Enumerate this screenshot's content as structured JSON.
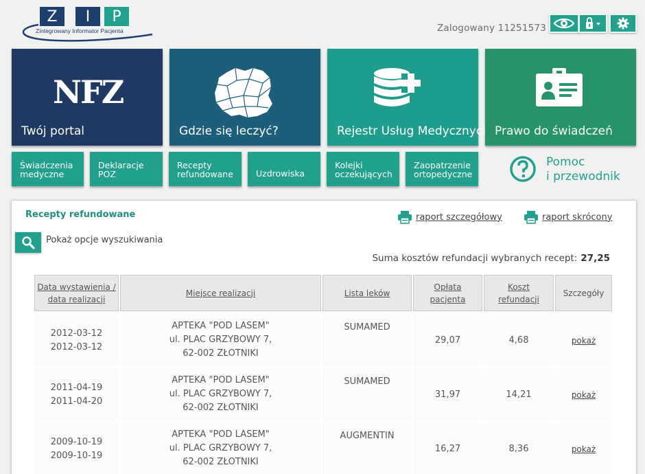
{
  "header": {
    "logo": {
      "letters": [
        "Z",
        "I",
        "P"
      ],
      "subtitle": "Zintegrowany Informator Pacjenta"
    },
    "logged_in": "Zalogowany 11251573",
    "buttons": [
      {
        "icon": "eye-icon"
      },
      {
        "icon": "lock-icon"
      },
      {
        "icon": "gear-icon"
      }
    ]
  },
  "tiles": [
    {
      "label": "Twój portal",
      "logo_text": "NFZ",
      "icon": "nfz-logo"
    },
    {
      "label": "Gdzie się leczyć?",
      "icon": "poland-map-icon"
    },
    {
      "label": "Rejestr Usług Medycznych",
      "icon": "database-plus-icon"
    },
    {
      "label": "Prawo do świadczeń",
      "icon": "id-card-icon"
    }
  ],
  "small_tiles": [
    {
      "line1": "Świadczenia",
      "line2": "medyczne"
    },
    {
      "line1": "Deklaracje",
      "line2": "POZ"
    },
    {
      "line1": "Recepty",
      "line2": "refundowane"
    },
    {
      "line1": "Uzdrowiska",
      "line2": ""
    },
    {
      "line1": "Kolejki",
      "line2": "oczekujących"
    },
    {
      "line1": "Zaopatrzenie",
      "line2": "ortopedyczne"
    }
  ],
  "help": {
    "line1": "Pomoc",
    "line2": "i przewodnik",
    "icon": "question-circle-icon"
  },
  "panel": {
    "title": "Recepty refundowane",
    "report_detailed": "raport szczegółowy",
    "report_short": "raport skrócony",
    "search_toggle": "Pokaż opcje wyszukiwania",
    "sum_label": "Suma kosztów refundacji wybranych recept:",
    "sum_value": "27,25"
  },
  "table": {
    "headers": [
      {
        "line1": "Data wystawienia /",
        "line2": "data realizacji"
      },
      {
        "line1": "Miejsce realizacji",
        "line2": ""
      },
      {
        "line1": "Lista leków",
        "line2": ""
      },
      {
        "line1": "Opłata",
        "line2": "pacjenta"
      },
      {
        "line1": "Koszt",
        "line2": "refundacji"
      },
      {
        "line1": "Szczegóły",
        "line2": ""
      }
    ],
    "rows": [
      {
        "issue_date": "2012-03-12",
        "realization_date": "2012-03-12",
        "place_line1": "APTEKA \"POD LASEM\"",
        "place_line2": "ul. PLAC GRZYBOWY 7,",
        "place_line3": "62-002 ZŁOTNIKI",
        "drugs": "SUMAMED",
        "patient_fee": "29,07",
        "refund_cost": "4,68",
        "details": "pokaż"
      },
      {
        "issue_date": "2011-04-19",
        "realization_date": "2011-04-20",
        "place_line1": "APTEKA \"POD LASEM\"",
        "place_line2": "ul. PLAC GRZYBOWY 7,",
        "place_line3": "62-002 ZŁOTNIKI",
        "drugs": "SUMAMED",
        "patient_fee": "31,97",
        "refund_cost": "14,21",
        "details": "pokaż"
      },
      {
        "issue_date": "2009-10-19",
        "realization_date": "2009-10-19",
        "place_line1": "APTEKA \"POD LASEM\"",
        "place_line2": "ul. PLAC GRZYBOWY 7,",
        "place_line3": "62-002 ZŁOTNIKI",
        "drugs": "AUGMENTIN",
        "patient_fee": "16,27",
        "refund_cost": "8,36",
        "details": "pokaż"
      }
    ]
  }
}
